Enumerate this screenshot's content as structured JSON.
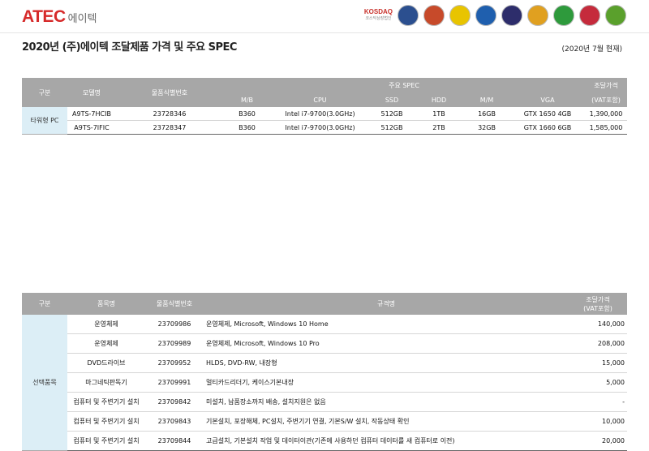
{
  "header": {
    "logo_main": "ATEC",
    "logo_sub": "에이텍",
    "cert_logos": [
      {
        "name": "kosdaq-logo",
        "line1": "KOSDAQ",
        "line2": "코스닥상장법인"
      },
      {
        "name": "emblem-1-icon",
        "color": "#2b4f8f"
      },
      {
        "name": "emblem-2-icon",
        "color": "#c74a2a"
      },
      {
        "name": "emblem-3-icon",
        "color": "#e8c400"
      },
      {
        "name": "emblem-4-icon",
        "color": "#1f5fae"
      },
      {
        "name": "emblem-5-icon",
        "color": "#2d2d6b"
      },
      {
        "name": "emblem-6-icon",
        "color": "#e0a020"
      },
      {
        "name": "green-label-icon",
        "color": "#2e9a3c"
      },
      {
        "name": "taegeuk-icon",
        "color": "#c52b3c"
      },
      {
        "name": "plant-icon",
        "color": "#5aa02c"
      }
    ]
  },
  "title": "2020년 (주)에이텍 조달제품 가격 및 주요 SPEC",
  "as_of": "(2020년 7월 현재)",
  "table1": {
    "headers": {
      "group": "구분",
      "model": "모델명",
      "product_id": "물품식별번호",
      "spec": "주요 SPEC",
      "price_line1": "조달가격",
      "price_line2": "(VAT포함)",
      "mb": "M/B",
      "cpu": "CPU",
      "ssd": "SSD",
      "hdd": "HDD",
      "mm": "M/M",
      "vga": "VGA"
    },
    "group_label": "타워형 PC",
    "rows": [
      {
        "model": "A9TS-7HCIB",
        "id": "23728346",
        "mb": "B360",
        "cpu": "Intel i7-9700(3.0GHz)",
        "ssd": "512GB",
        "hdd": "1TB",
        "mm": "16GB",
        "vga": "GTX 1650 4GB",
        "price": "1,390,000"
      },
      {
        "model": "A9TS-7IFIC",
        "id": "23728347",
        "mb": "B360",
        "cpu": "Intel i7-9700(3.0GHz)",
        "ssd": "512GB",
        "hdd": "2TB",
        "mm": "32GB",
        "vga": "GTX 1660 6GB",
        "price": "1,585,000"
      }
    ]
  },
  "table2": {
    "headers": {
      "group": "구분",
      "item": "품목명",
      "product_id": "물품식별번호",
      "spec": "규격명",
      "price_line1": "조달가격",
      "price_line2": "(VAT포함)"
    },
    "group_label": "선택품목",
    "rows": [
      {
        "item": "운영체제",
        "id": "23709986",
        "spec": "운영체제, Microsoft, Windows 10 Home",
        "price": "140,000"
      },
      {
        "item": "운영체제",
        "id": "23709989",
        "spec": "운영체제, Microsoft, Windows 10 Pro",
        "price": "208,000"
      },
      {
        "item": "DVD드라이브",
        "id": "23709952",
        "spec": "HLDS, DVD-RW, 내장형",
        "price": "15,000"
      },
      {
        "item": "마그네틱판독기",
        "id": "23709991",
        "spec": "멀티카드리더기, 케이스기본내장",
        "price": "5,000"
      },
      {
        "item": "컴퓨터 및 주변기기 설치",
        "id": "23709842",
        "spec": "미설치, 납품장소까지 배송, 설치지원은 없음",
        "price": "-"
      },
      {
        "item": "컴퓨터 및 주변기기 설치",
        "id": "23709843",
        "spec": "기본설치, 포장해체, PC설치, 주변기기 연결, 기본S/W 설치, 작동상태 확인",
        "price": "10,000"
      },
      {
        "item": "컴퓨터 및 주변기기 설치",
        "id": "23709844",
        "spec": "고급설치, 기본설치 작업 및 데이터이관(기존에 사용하던 컴퓨터 데이터를 새 컴퓨터로 이전)",
        "price": "20,000"
      }
    ]
  }
}
